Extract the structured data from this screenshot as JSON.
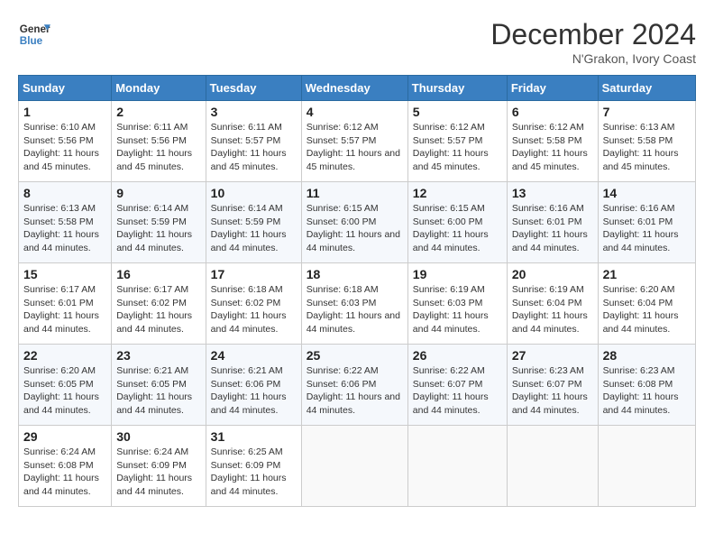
{
  "logo": {
    "text_general": "General",
    "text_blue": "Blue"
  },
  "header": {
    "month": "December 2024",
    "location": "N'Grakon, Ivory Coast"
  },
  "days_of_week": [
    "Sunday",
    "Monday",
    "Tuesday",
    "Wednesday",
    "Thursday",
    "Friday",
    "Saturday"
  ],
  "weeks": [
    [
      {
        "day": "1",
        "sunrise": "6:10 AM",
        "sunset": "5:56 PM",
        "daylight": "11 hours and 45 minutes."
      },
      {
        "day": "2",
        "sunrise": "6:11 AM",
        "sunset": "5:56 PM",
        "daylight": "11 hours and 45 minutes."
      },
      {
        "day": "3",
        "sunrise": "6:11 AM",
        "sunset": "5:57 PM",
        "daylight": "11 hours and 45 minutes."
      },
      {
        "day": "4",
        "sunrise": "6:12 AM",
        "sunset": "5:57 PM",
        "daylight": "11 hours and 45 minutes."
      },
      {
        "day": "5",
        "sunrise": "6:12 AM",
        "sunset": "5:57 PM",
        "daylight": "11 hours and 45 minutes."
      },
      {
        "day": "6",
        "sunrise": "6:12 AM",
        "sunset": "5:58 PM",
        "daylight": "11 hours and 45 minutes."
      },
      {
        "day": "7",
        "sunrise": "6:13 AM",
        "sunset": "5:58 PM",
        "daylight": "11 hours and 45 minutes."
      }
    ],
    [
      {
        "day": "8",
        "sunrise": "6:13 AM",
        "sunset": "5:58 PM",
        "daylight": "11 hours and 44 minutes."
      },
      {
        "day": "9",
        "sunrise": "6:14 AM",
        "sunset": "5:59 PM",
        "daylight": "11 hours and 44 minutes."
      },
      {
        "day": "10",
        "sunrise": "6:14 AM",
        "sunset": "5:59 PM",
        "daylight": "11 hours and 44 minutes."
      },
      {
        "day": "11",
        "sunrise": "6:15 AM",
        "sunset": "6:00 PM",
        "daylight": "11 hours and 44 minutes."
      },
      {
        "day": "12",
        "sunrise": "6:15 AM",
        "sunset": "6:00 PM",
        "daylight": "11 hours and 44 minutes."
      },
      {
        "day": "13",
        "sunrise": "6:16 AM",
        "sunset": "6:01 PM",
        "daylight": "11 hours and 44 minutes."
      },
      {
        "day": "14",
        "sunrise": "6:16 AM",
        "sunset": "6:01 PM",
        "daylight": "11 hours and 44 minutes."
      }
    ],
    [
      {
        "day": "15",
        "sunrise": "6:17 AM",
        "sunset": "6:01 PM",
        "daylight": "11 hours and 44 minutes."
      },
      {
        "day": "16",
        "sunrise": "6:17 AM",
        "sunset": "6:02 PM",
        "daylight": "11 hours and 44 minutes."
      },
      {
        "day": "17",
        "sunrise": "6:18 AM",
        "sunset": "6:02 PM",
        "daylight": "11 hours and 44 minutes."
      },
      {
        "day": "18",
        "sunrise": "6:18 AM",
        "sunset": "6:03 PM",
        "daylight": "11 hours and 44 minutes."
      },
      {
        "day": "19",
        "sunrise": "6:19 AM",
        "sunset": "6:03 PM",
        "daylight": "11 hours and 44 minutes."
      },
      {
        "day": "20",
        "sunrise": "6:19 AM",
        "sunset": "6:04 PM",
        "daylight": "11 hours and 44 minutes."
      },
      {
        "day": "21",
        "sunrise": "6:20 AM",
        "sunset": "6:04 PM",
        "daylight": "11 hours and 44 minutes."
      }
    ],
    [
      {
        "day": "22",
        "sunrise": "6:20 AM",
        "sunset": "6:05 PM",
        "daylight": "11 hours and 44 minutes."
      },
      {
        "day": "23",
        "sunrise": "6:21 AM",
        "sunset": "6:05 PM",
        "daylight": "11 hours and 44 minutes."
      },
      {
        "day": "24",
        "sunrise": "6:21 AM",
        "sunset": "6:06 PM",
        "daylight": "11 hours and 44 minutes."
      },
      {
        "day": "25",
        "sunrise": "6:22 AM",
        "sunset": "6:06 PM",
        "daylight": "11 hours and 44 minutes."
      },
      {
        "day": "26",
        "sunrise": "6:22 AM",
        "sunset": "6:07 PM",
        "daylight": "11 hours and 44 minutes."
      },
      {
        "day": "27",
        "sunrise": "6:23 AM",
        "sunset": "6:07 PM",
        "daylight": "11 hours and 44 minutes."
      },
      {
        "day": "28",
        "sunrise": "6:23 AM",
        "sunset": "6:08 PM",
        "daylight": "11 hours and 44 minutes."
      }
    ],
    [
      {
        "day": "29",
        "sunrise": "6:24 AM",
        "sunset": "6:08 PM",
        "daylight": "11 hours and 44 minutes."
      },
      {
        "day": "30",
        "sunrise": "6:24 AM",
        "sunset": "6:09 PM",
        "daylight": "11 hours and 44 minutes."
      },
      {
        "day": "31",
        "sunrise": "6:25 AM",
        "sunset": "6:09 PM",
        "daylight": "11 hours and 44 minutes."
      },
      null,
      null,
      null,
      null
    ]
  ]
}
